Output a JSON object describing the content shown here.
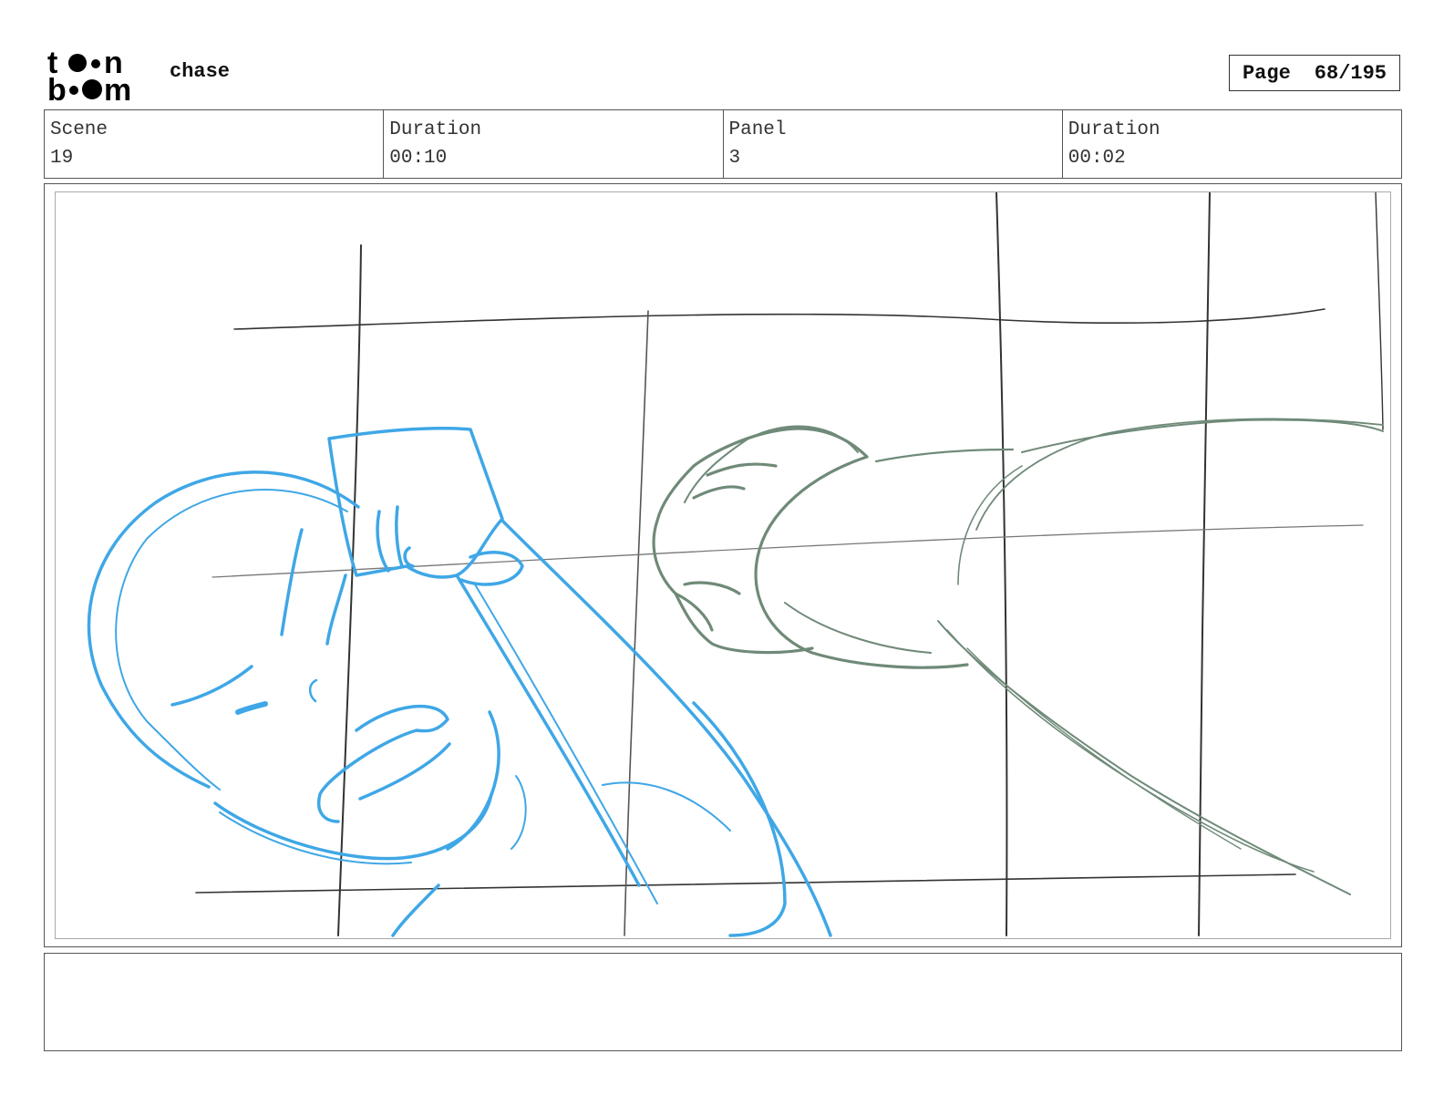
{
  "header": {
    "logo_name": "toonboom-logo",
    "title": "chase",
    "page_label": "Page",
    "page_value": "68/195"
  },
  "info": {
    "scene_label": "Scene",
    "scene_value": "19",
    "duration_label": "Duration",
    "duration_value": "00:10",
    "panel_label": "Panel",
    "panel_value": "3",
    "panel_duration_label": "Duration",
    "panel_duration_value": "00:02"
  },
  "notes": {
    "text": ""
  },
  "colors": {
    "sketch_blue": "#3fa7e6",
    "sketch_green": "#6f8a78",
    "grid_line": "#333333"
  }
}
